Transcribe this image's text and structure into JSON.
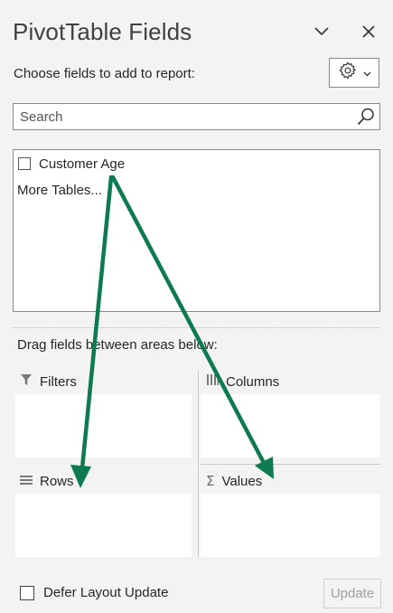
{
  "pane": {
    "title": "PivotTable Fields",
    "subtitle": "Choose fields to add to report:",
    "header_icons": [
      "chevron-down-icon",
      "close-icon"
    ],
    "tools_icon": "gear-icon"
  },
  "search": {
    "placeholder": "Search",
    "value": ""
  },
  "fields": [
    {
      "label": "Customer Age",
      "checked": false
    }
  ],
  "more_tables": "More Tables...",
  "areas": {
    "instruction": "Drag fields between areas below:",
    "filters": {
      "label": "Filters",
      "icon": "filter-icon"
    },
    "columns": {
      "label": "Columns",
      "icon": "columns-icon"
    },
    "rows": {
      "label": "Rows",
      "icon": "rows-icon"
    },
    "values": {
      "label": "Values",
      "icon": "sigma-icon"
    }
  },
  "footer": {
    "defer_label": "Defer Layout Update",
    "defer_checked": false,
    "update_label": "Update",
    "update_enabled": false
  },
  "colors": {
    "background": "#f3f3f3",
    "annotation_arrow": "#0e7a4f",
    "border": "#8a8a8a"
  }
}
